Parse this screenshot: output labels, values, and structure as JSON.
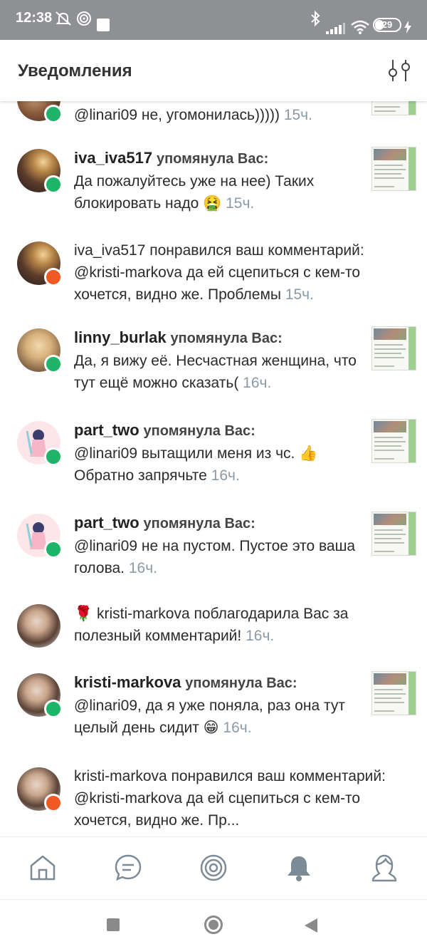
{
  "status_bar": {
    "time": "12:38",
    "battery": "29",
    "icons": [
      "mute-icon",
      "cast-icon",
      "notification-square-icon",
      "bluetooth-icon",
      "signal-icon",
      "wifi-icon",
      "battery-icon",
      "charging-icon"
    ]
  },
  "header": {
    "title": "Уведомления",
    "filter_icon": "filter-sliders-icon"
  },
  "notifications": [
    {
      "type": "comment",
      "username": "",
      "action": "",
      "text": "@linari09 не, угомонилась)))))",
      "time": "15ч.",
      "has_thumbnail": true,
      "avatar": "avatar-1"
    },
    {
      "type": "comment",
      "username": "iva_iva517",
      "action": "упомянула Вас:",
      "text": "Да пожалуйтесь уже на нее)  Таких блокировать надо 🤮",
      "time": "15ч.",
      "has_thumbnail": true,
      "avatar": "avatar-iva"
    },
    {
      "type": "like",
      "username": "",
      "action": "",
      "text": "iva_iva517 понравился ваш комментарий: @kristi-markova да ей сцепиться с кем-то хочется, видно же. Проблемы",
      "time": "15ч.",
      "has_thumbnail": false,
      "avatar": "avatar-iva"
    },
    {
      "type": "comment",
      "username": "linny_burlak",
      "action": "упомянула Вас:",
      "text": "Да, я вижу её. Несчастная женщина, что тут ещё можно сказать(",
      "time": "16ч.",
      "has_thumbnail": true,
      "avatar": "avatar-linny"
    },
    {
      "type": "comment",
      "username": "part_two",
      "action": "упомянула Вас:",
      "text": "@linari09 вытащили меня из чс. 👍 Обратно запрячьте",
      "time": "16ч.",
      "has_thumbnail": true,
      "avatar": "avatar-part"
    },
    {
      "type": "comment",
      "username": "part_two",
      "action": "упомянула Вас:",
      "text": "@linari09 не на пустом. Пустое это ваша голова.",
      "time": "16ч.",
      "has_thumbnail": true,
      "avatar": "avatar-part"
    },
    {
      "type": "thanks",
      "username": "",
      "action": "",
      "text": "🌹 kristi-markova поблагодарила Вас за полезный комментарий!",
      "time": "16ч.",
      "has_thumbnail": false,
      "avatar": "avatar-kristi"
    },
    {
      "type": "comment",
      "username": "kristi-markova",
      "action": "упомянула Вас:",
      "text": "@linari09, да я уже поняла, раз она тут целый день сидит 😁",
      "time": "16ч.",
      "has_thumbnail": true,
      "avatar": "avatar-kristi"
    },
    {
      "type": "like",
      "username": "",
      "action": "",
      "text": "kristi-markova понравился ваш комментарий: @kristi-markova да ей сцепиться с кем-то хочется, видно же. Пр...",
      "time": "",
      "has_thumbnail": false,
      "avatar": "avatar-kristi"
    }
  ],
  "bottom_nav": [
    {
      "name": "home-icon",
      "active": false
    },
    {
      "name": "chat-icon",
      "active": false
    },
    {
      "name": "target-icon",
      "active": false
    },
    {
      "name": "bell-icon",
      "active": true
    },
    {
      "name": "profile-icon",
      "active": false
    }
  ],
  "colors": {
    "status_bar": "#8e9094",
    "comment_badge": "#1fb46a",
    "like_badge": "#f05a22",
    "time_text": "#8b9aa6",
    "nav_icon": "#7d8b96"
  }
}
